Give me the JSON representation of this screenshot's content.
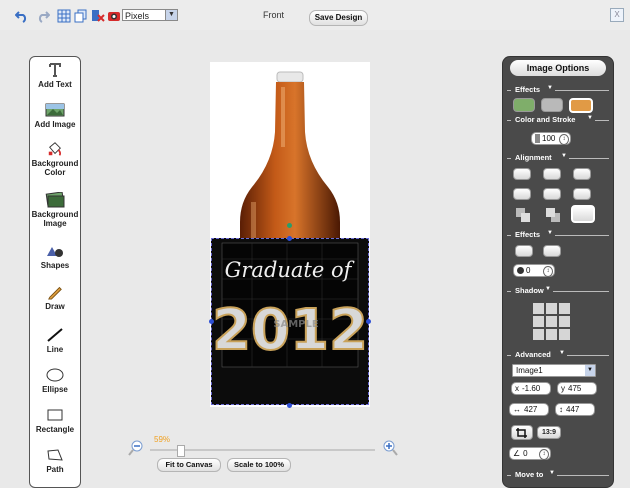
{
  "topbar": {
    "icons": [
      "undo-icon",
      "redo-icon",
      "grid-icon",
      "copy-icon",
      "delete-icon",
      "preview-icon"
    ],
    "unit_select": "Pixels",
    "view_label": "Front",
    "save_label": "Save Design",
    "close_label": "X"
  },
  "toolbox": {
    "items": [
      {
        "label": "Add Text",
        "icon": "text-tool-icon"
      },
      {
        "label": "Add Image",
        "icon": "image-tool-icon"
      },
      {
        "label": "Background Color",
        "icon": "bucket-icon"
      },
      {
        "label": "Background Image",
        "icon": "background-image-icon"
      },
      {
        "label": "Shapes",
        "icon": "shapes-icon"
      },
      {
        "label": "Draw",
        "icon": "pencil-icon"
      },
      {
        "label": "Line",
        "icon": "line-icon"
      },
      {
        "label": "Ellipse",
        "icon": "ellipse-icon"
      },
      {
        "label": "Rectangle",
        "icon": "rectangle-icon"
      },
      {
        "label": "Path",
        "icon": "path-icon"
      }
    ]
  },
  "canvas": {
    "label_title": "Graduate of",
    "label_year": "2012",
    "watermark": "SAMPLE"
  },
  "zoom": {
    "percent": "59%",
    "level": 0.59,
    "fit_label": "Fit to Canvas",
    "scale_label": "Scale to 100%"
  },
  "panel": {
    "title": "Image Options",
    "sections": {
      "effects": "Effects",
      "color_stroke": "Color and Stroke",
      "alignment": "Alignment",
      "effects2": "Effects",
      "shadow": "Shadow",
      "advanced": "Advanced",
      "move_to": "Move to"
    },
    "opacity": "100",
    "effect_amount": "0",
    "layer_select": "Image1",
    "x_label": "x",
    "x_value": "-1.60",
    "y_label": "y",
    "y_value": "475",
    "w_value": "427",
    "h_value": "447",
    "crop_ratio": "13:9",
    "angle": "0"
  }
}
